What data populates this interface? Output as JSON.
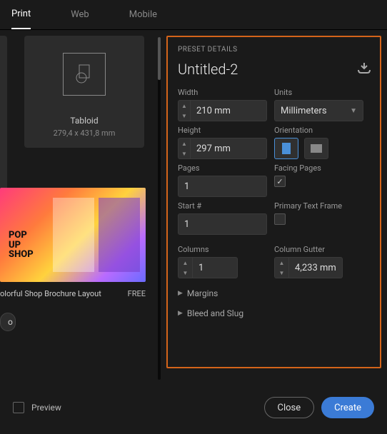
{
  "tabs": {
    "print": "Print",
    "web": "Web",
    "mobile": "Mobile"
  },
  "preset_card": {
    "name": "Tabloid",
    "dims": "279,4 x 431,8 mm"
  },
  "template": {
    "title": "olorful Shop Brochure Layout",
    "price": "FREE",
    "pop": "POP\nUP\nSHOP"
  },
  "chip": {
    "label": "o"
  },
  "panel": {
    "section": "PRESET DETAILS",
    "doc_name": "Untitled-2",
    "width_label": "Width",
    "width": "210 mm",
    "units_label": "Units",
    "units": "Millimeters",
    "height_label": "Height",
    "height": "297 mm",
    "orientation_label": "Orientation",
    "pages_label": "Pages",
    "pages": "1",
    "facing_label": "Facing Pages",
    "facing_checked": true,
    "start_label": "Start #",
    "start": "1",
    "ptf_label": "Primary Text Frame",
    "ptf_checked": false,
    "columns_label": "Columns",
    "columns": "1",
    "gutter_label": "Column Gutter",
    "gutter": "4,233 mm",
    "margins": "Margins",
    "bleed": "Bleed and Slug"
  },
  "footer": {
    "preview": "Preview",
    "close": "Close",
    "create": "Create"
  }
}
